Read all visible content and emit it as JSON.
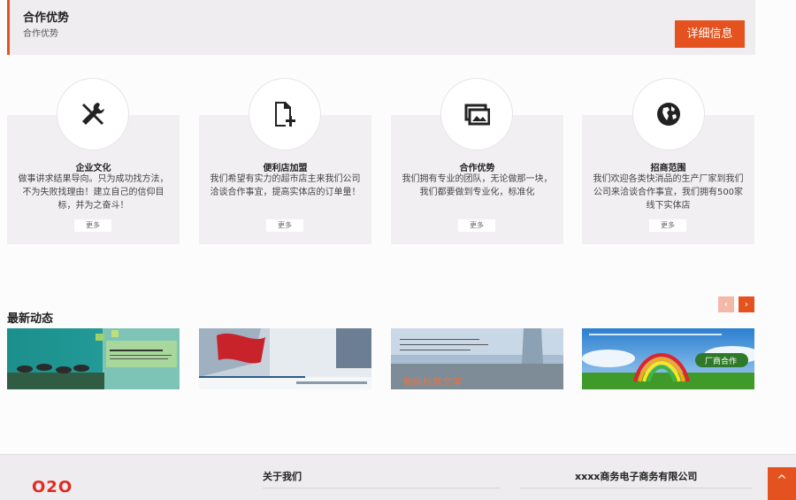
{
  "header": {
    "title": "合作优势",
    "subtitle": "合作优势",
    "detail_button": "详细信息"
  },
  "cards": [
    {
      "icon": "tools-icon",
      "title": "企业文化",
      "desc": "做事讲求结果导向。只为成功找方法，不为失败找理由！建立自己的信仰目标，并为之奋斗！",
      "more": "更多"
    },
    {
      "icon": "document-add-icon",
      "title": "便利店加盟",
      "desc": "我们希望有实力的超市店主来我们公司洽谈合作事宜，提高实体店的订单量！",
      "more": "更多"
    },
    {
      "icon": "gallery-icon",
      "title": "合作优势",
      "desc": "我们拥有专业的团队，无论做那一块，我们都要做到专业化，标准化",
      "more": "更多"
    },
    {
      "icon": "globe-icon",
      "title": "招商范围",
      "desc": "我们欢迎各类快消品的生产厂家到我们公司来洽谈合作事宜，我们拥有500家线下实体店",
      "more": "更多"
    }
  ],
  "news": {
    "title": "最新动态",
    "prev": "‹",
    "next": "›",
    "thumbs": [
      {
        "name": "horses-banner"
      },
      {
        "name": "flag-banner"
      },
      {
        "name": "city-banner",
        "caption": "新闻标题文字"
      },
      {
        "name": "rainbow-banner",
        "badge": "厂商合作"
      }
    ]
  },
  "footer": {
    "logo": "O2O",
    "about": "关于我们",
    "company": "xxxx商务电子商务有限公司",
    "to_top": "^"
  },
  "colors": {
    "accent": "#e4521f",
    "logo": "#e02a22"
  }
}
